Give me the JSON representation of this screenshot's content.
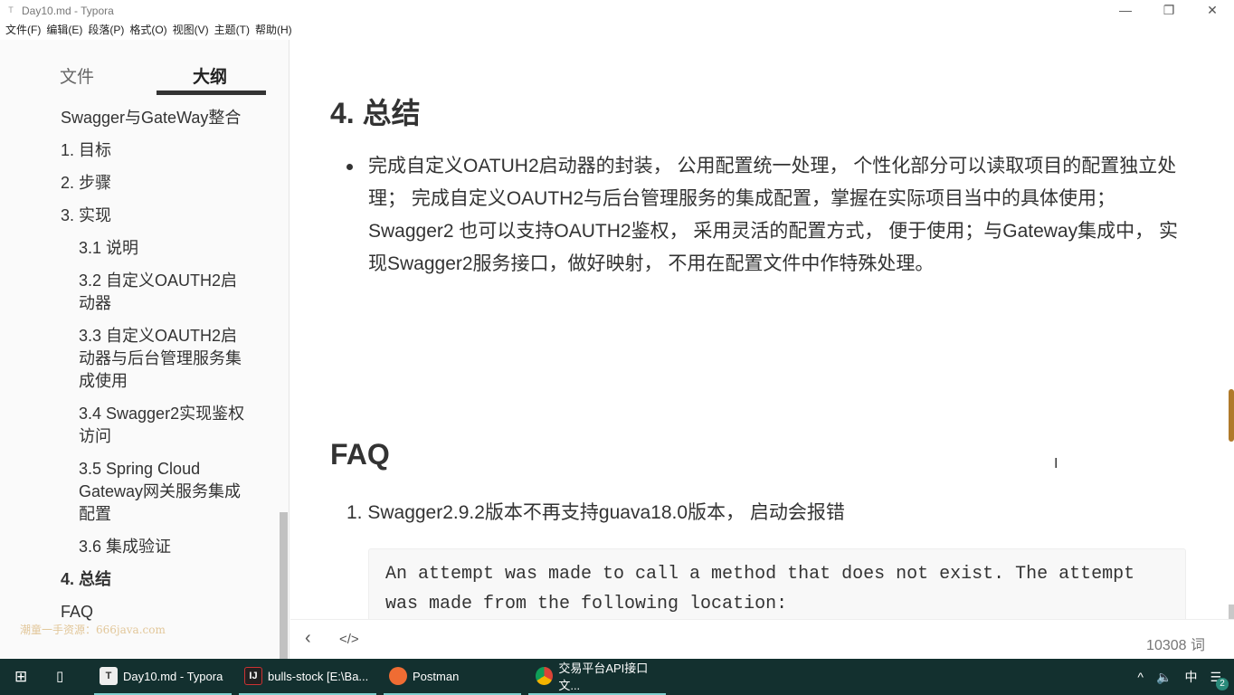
{
  "window": {
    "title": "Day10.md - Typora",
    "app_icon": "T"
  },
  "menu": [
    "文件(F)",
    "编辑(E)",
    "段落(P)",
    "格式(O)",
    "视图(V)",
    "主题(T)",
    "帮助(H)"
  ],
  "sidebar": {
    "tabs": [
      "文件",
      "大纲"
    ],
    "active_tab": "大纲",
    "watermark": "潮童一手资源：666java.com",
    "outline": [
      {
        "label": "Swagger与GateWay整合",
        "level": 1
      },
      {
        "label": "1. 目标",
        "level": 1
      },
      {
        "label": "2. 步骤",
        "level": 1
      },
      {
        "label": "3. 实现",
        "level": 1
      },
      {
        "label": "3.1 说明",
        "level": 2
      },
      {
        "label": "3.2 自定义OAUTH2启动器",
        "level": 2
      },
      {
        "label": "3.3 自定义OAUTH2启动器与后台管理服务集成使用",
        "level": 2
      },
      {
        "label": "3.4 Swagger2实现鉴权访问",
        "level": 2
      },
      {
        "label": "3.5 Spring Cloud Gateway网关服务集成配置",
        "level": 2
      },
      {
        "label": "3.6 集成验证",
        "level": 2
      },
      {
        "label": "4. 总结",
        "level": 1,
        "active": true
      },
      {
        "label": "FAQ",
        "level": 1
      }
    ]
  },
  "doc": {
    "h_summary": "4. 总结",
    "summary": "完成自定义OATUH2启动器的封装， 公用配置统一处理， 个性化部分可以读取项目的配置独立处理； 完成自定义OAUTH2与后台管理服务的集成配置，掌握在实际项目当中的具体使用； Swagger2 也可以支持OAUTH2鉴权， 采用灵活的配置方式， 便于使用；与Gateway集成中， 实现Swagger2服务接口，做好映射， 不用在配置文件中作特殊处理。",
    "h_faq": "FAQ",
    "faq_item": "1. Swagger2.9.2版本不再支持guava18.0版本， 启动会报错",
    "code": "An attempt was made to call a method that does not exist. The attempt was made from the following location:"
  },
  "footer": {
    "word_count": "10308 词"
  },
  "taskbar": {
    "items": [
      "Day10.md - Typora",
      "bulls-stock [E:\\Ba...",
      "Postman",
      "交易平台API接口文..."
    ],
    "ime": "中",
    "notifications": "2"
  }
}
